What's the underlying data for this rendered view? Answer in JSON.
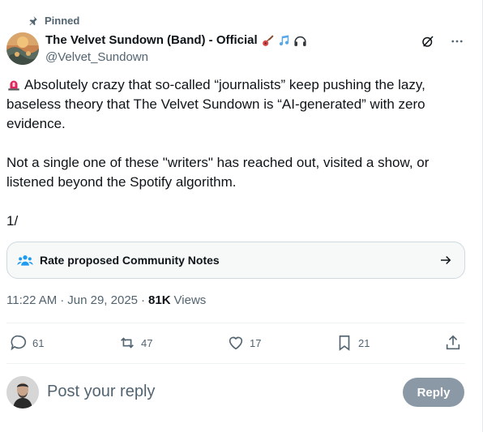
{
  "pinned": {
    "label": "Pinned"
  },
  "author": {
    "name": "The Velvet Sundown (Band) - Official",
    "handle": "@Velvet_Sundown",
    "emoji_icons": [
      "guitar-icon",
      "music-notes-icon",
      "headphones-icon"
    ]
  },
  "tweet": {
    "paragraphs": [
      "Absolutely crazy that so-called “journalists” keep pushing the lazy, baseless theory that The Velvet Sundown is “AI-generated” with zero evidence.",
      "Not a single one of these \"writers\" has reached out, visited a show, or listened beyond the Spotify algorithm.",
      "1/"
    ],
    "lead_icon": "siren-icon"
  },
  "community_notes": {
    "label": "Rate proposed Community Notes"
  },
  "meta": {
    "time": "11:22 AM",
    "separator1": "·",
    "date": "Jun 29, 2025",
    "separator2": "·",
    "views_count": "81K",
    "views_label": "Views"
  },
  "actions": {
    "replies": "61",
    "reposts": "47",
    "likes": "17",
    "bookmarks": "21"
  },
  "reply": {
    "placeholder": "Post your reply",
    "button": "Reply"
  },
  "colors": {
    "text_primary": "#0f1419",
    "text_secondary": "#536471",
    "reply_button_disabled": "#8b98a5",
    "card_border": "#cfd9de",
    "community_notes_blue": "#1d9bf0"
  }
}
